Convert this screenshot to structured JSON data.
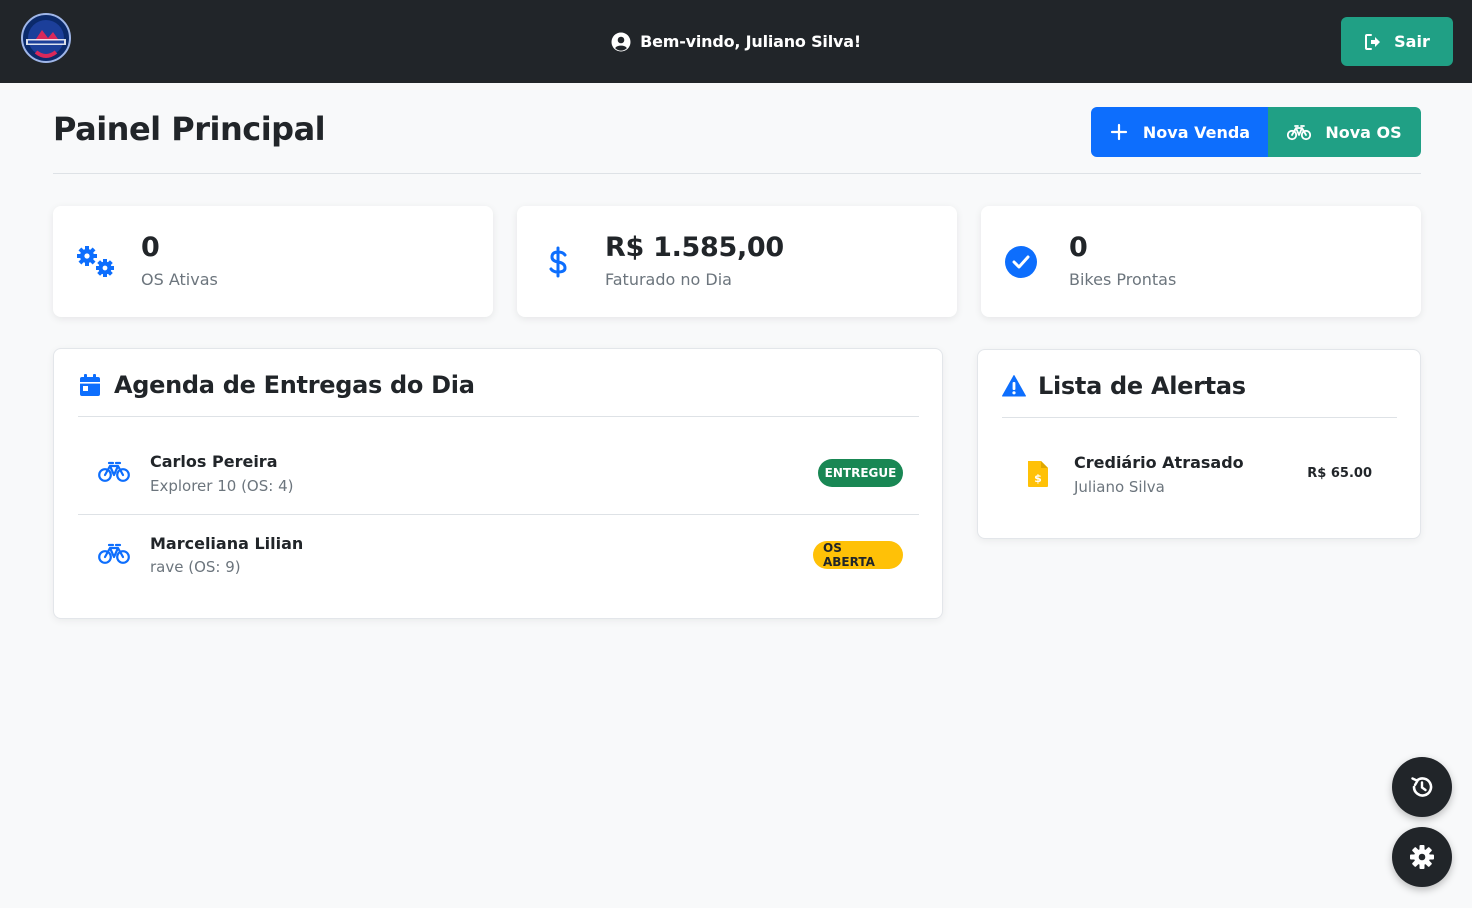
{
  "navbar": {
    "welcome": "Bem-vindo, Juliano Silva!",
    "logout_label": "Sair"
  },
  "header": {
    "title": "Painel Principal",
    "new_sale_label": "Nova Venda",
    "new_os_label": "Nova OS"
  },
  "stats": [
    {
      "value": "0",
      "label": "OS Ativas",
      "icon": "gears-icon"
    },
    {
      "value": "R$ 1.585,00",
      "label": "Faturado no Dia",
      "icon": "dollar-icon"
    },
    {
      "value": "0",
      "label": "Bikes Prontas",
      "icon": "check-circle-icon"
    }
  ],
  "agenda": {
    "title": "Agenda de Entregas do Dia",
    "items": [
      {
        "name": "Carlos Pereira",
        "detail": "Explorer 10 (OS: 4)",
        "status": "ENTREGUE"
      },
      {
        "name": "Marceliana Lilian",
        "detail": "rave (OS: 9)",
        "status": "OS ABERTA"
      }
    ]
  },
  "alerts": {
    "title": "Lista de Alertas",
    "items": [
      {
        "title": "Crediário Atrasado",
        "subtitle": "Juliano Silva",
        "amount": "R$ 65.00"
      }
    ]
  },
  "colors": {
    "primary": "#0d6efd",
    "teal": "#20a085",
    "dark": "#212529",
    "success": "#198754",
    "warning": "#ffc107"
  }
}
